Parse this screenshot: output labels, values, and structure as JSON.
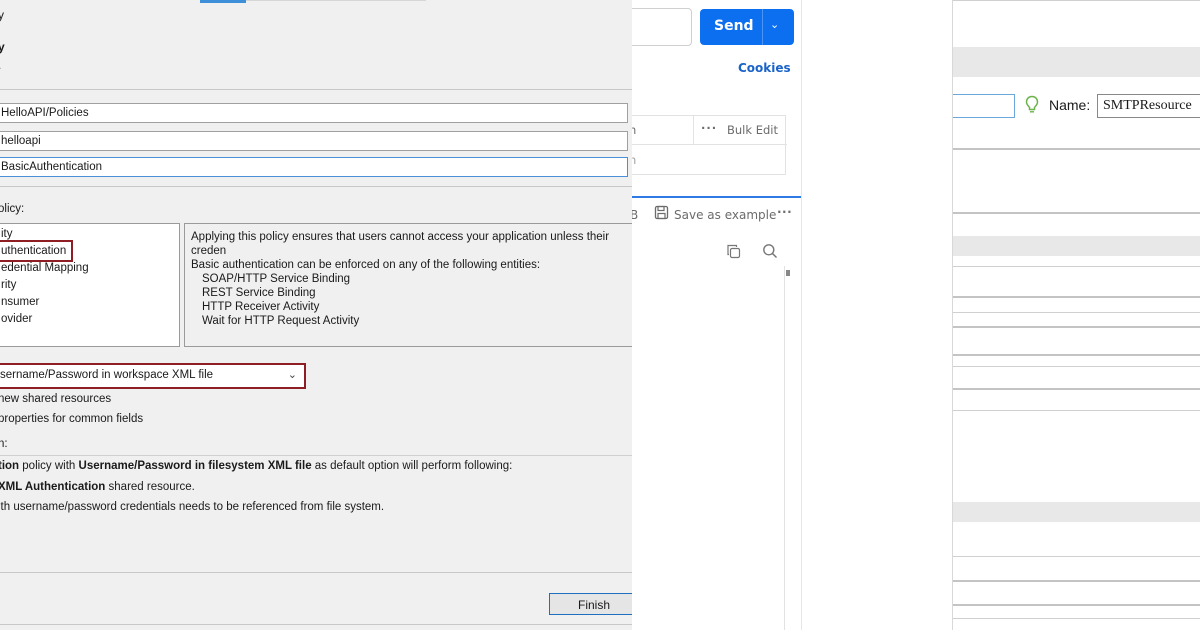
{
  "wizard": {
    "frag_y": "y",
    "frag_y2": "y",
    "frag_dot": ".",
    "folder_value": "HelloAPI/Policies",
    "package_value": "helloapi",
    "policy_name_value": "BasicAuthentication",
    "select_policy_label": "olicy:",
    "policy_list": [
      "ity",
      "uthentication",
      "edential Mapping",
      "rity",
      "nsumer",
      "ovider"
    ],
    "description_lines": [
      "Applying this policy ensures that users cannot access your application unless their creden",
      "Basic authentication can be enforced on any of the following entities:"
    ],
    "description_entities": [
      "SOAP/HTTP Service Binding",
      "REST Service Binding",
      "HTTP Receiver Activity",
      "Wait for HTTP Request Activity"
    ],
    "combo_value": "sername/Password in workspace XML file",
    "check_new_shared": "new shared resources",
    "check_properties": "properties for common fields",
    "section_label": "n:",
    "info_line1": {
      "p1": "tion",
      "p2": " policy with ",
      "p3": "Username/Password in filesystem XML file",
      "p4": " as default option will perform following:"
    },
    "info_line2": {
      "p1": "XML Authentication",
      "p2": " shared resource."
    },
    "info_line3": "ith username/password credentials needs to be referenced from file system.",
    "finish_label": "Finish"
  },
  "postman": {
    "send_label": "Send",
    "cookies_label": "Cookies",
    "kv_header_frag": "n",
    "bulk_edit_label": "Bulk Edit",
    "kv_row_frag": "n",
    "tab_frag": "B",
    "save_example_label": "Save as example"
  },
  "settings": {
    "name_label": "Name:",
    "name_value": "SMTPResource"
  },
  "colors": {
    "highlight_red": "#8f1d24",
    "send_blue": "#0b6ff0",
    "link_blue": "#1a63c9"
  },
  "icons": [
    "chevron-down-icon",
    "more-icon",
    "save-icon",
    "copy-icon",
    "search-icon",
    "lightbulb-icon"
  ]
}
